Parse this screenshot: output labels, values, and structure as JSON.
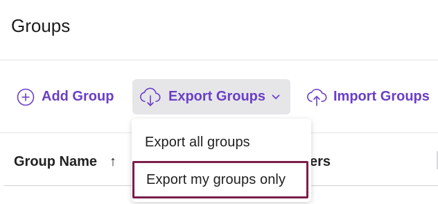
{
  "page": {
    "title": "Groups"
  },
  "toolbar": {
    "add_label": "Add Group",
    "export_label": "Export Groups",
    "import_label": "Import Groups"
  },
  "export_menu": {
    "items": [
      {
        "label": "Export all groups"
      },
      {
        "label": "Export my groups only",
        "focused": true
      }
    ]
  },
  "table": {
    "columns": [
      {
        "label": "Group Name",
        "sort": "ascending",
        "sort_icon": "↑"
      },
      {
        "label": "ers"
      }
    ]
  },
  "colors": {
    "accent": "#6a3fc6",
    "button_bg": "#e6e6e9",
    "focus_ring": "#7a1e48"
  },
  "icons": {
    "add": "plus-circle-icon",
    "export": "cloud-download-icon",
    "export_chevron": "chevron-down-icon",
    "import": "cloud-upload-icon",
    "sort": "arrow-up-icon"
  }
}
